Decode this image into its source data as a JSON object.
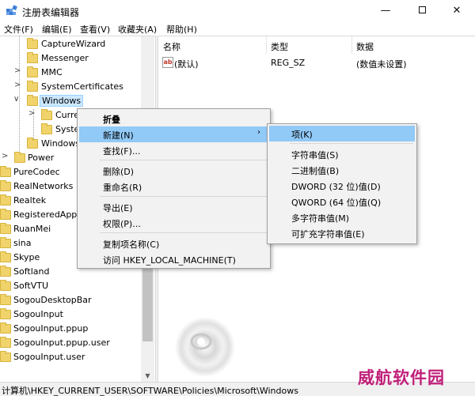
{
  "window": {
    "title": "注册表编辑器",
    "minimize_glyph": "—",
    "close_glyph": "✕"
  },
  "menubar": {
    "items": [
      "文件(F)",
      "编辑(E)",
      "查看(V)",
      "收藏夹(A)",
      "帮助(H)"
    ]
  },
  "tree": {
    "expand_glyph": ">",
    "collapse_glyph": "∨",
    "items": [
      {
        "label": "CaptureWizard"
      },
      {
        "label": "Messenger"
      },
      {
        "label": "MMC"
      },
      {
        "label": "SystemCertificates"
      },
      {
        "label": "Windows",
        "selected": true
      },
      {
        "label": "Curre"
      },
      {
        "label": "Syster"
      },
      {
        "label": "Windows"
      },
      {
        "label": "Power"
      },
      {
        "label": "PureCodec"
      },
      {
        "label": "RealNetworks"
      },
      {
        "label": "Realtek"
      },
      {
        "label": "RegisteredAppl"
      },
      {
        "label": "RuanMei"
      },
      {
        "label": "sina"
      },
      {
        "label": "Skype"
      },
      {
        "label": "Softland"
      },
      {
        "label": "SoftVTU"
      },
      {
        "label": "SogouDesktopBar"
      },
      {
        "label": "SogouInput"
      },
      {
        "label": "SogouInput.ppup"
      },
      {
        "label": "SogouInput.ppup.user"
      },
      {
        "label": "SogouInput.user"
      }
    ]
  },
  "list": {
    "columns": [
      "名称",
      "类型",
      "数据"
    ],
    "rows": [
      {
        "icon": "ab",
        "name": "(默认)",
        "type": "REG_SZ",
        "data": "(数值未设置)"
      }
    ]
  },
  "context_menu": {
    "items": [
      {
        "label": "折叠",
        "bold": true
      },
      {
        "label": "新建(N)",
        "highlight": true,
        "submenu_arrow": "›"
      },
      {
        "label": "查找(F)..."
      },
      {
        "label": "删除(D)"
      },
      {
        "label": "重命名(R)"
      },
      {
        "label": "导出(E)"
      },
      {
        "label": "权限(P)..."
      },
      {
        "label": "复制项名称(C)"
      },
      {
        "label": "访问 HKEY_LOCAL_MACHINE(T)"
      }
    ]
  },
  "submenu": {
    "items": [
      {
        "label": "项(K)",
        "highlight": true
      },
      {
        "label": "字符串值(S)"
      },
      {
        "label": "二进制值(B)"
      },
      {
        "label": "DWORD (32 位)值(D)"
      },
      {
        "label": "QWORD (64 位)值(Q)"
      },
      {
        "label": "多字符串值(M)"
      },
      {
        "label": "可扩充字符串值(E)"
      }
    ]
  },
  "statusbar": {
    "path": "计算机\\HKEY_CURRENT_USER\\SOFTWARE\\Policies\\Microsoft\\Windows"
  },
  "watermark": {
    "text": "威航软件园",
    "color": "#c0207a"
  },
  "colors": {
    "highlight": "#91c9f7",
    "selection": "#cce8ff",
    "folder": "#f0d36b"
  }
}
